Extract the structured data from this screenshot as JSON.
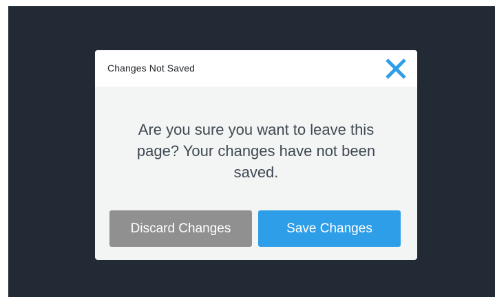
{
  "dialog": {
    "title": "Changes Not Saved",
    "close_icon": "close-x-icon",
    "message": "Are you sure you want to leave this page? Your changes have not been saved.",
    "discard_label": "Discard Changes",
    "save_label": "Save Changes"
  },
  "colors": {
    "backdrop": "#222a35",
    "dialog_body": "#f3f5f4",
    "header": "#ffffff",
    "accent": "#2f9ee9",
    "discard_button": "#909090"
  }
}
